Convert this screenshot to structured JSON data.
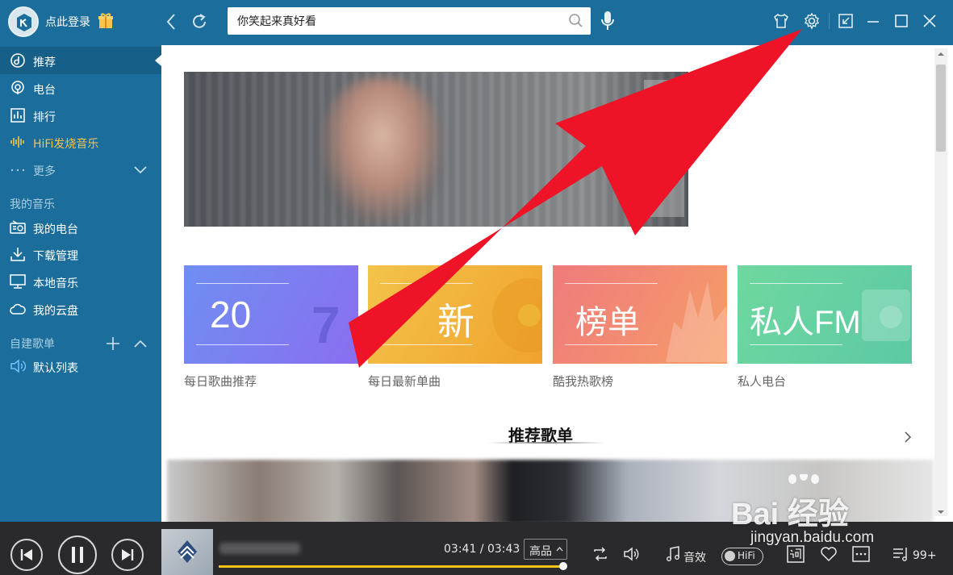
{
  "titlebar": {
    "login_text": "点此登录",
    "search_value": "你笑起来真好看"
  },
  "sidebar": {
    "items": [
      {
        "label": "推荐",
        "icon": "recommend-icon"
      },
      {
        "label": "电台",
        "icon": "radio-icon"
      },
      {
        "label": "排行",
        "icon": "chart-icon"
      },
      {
        "label": "HiFi发烧音乐",
        "icon": "waveform-icon"
      },
      {
        "label": "更多",
        "icon": "dots-icon"
      }
    ],
    "my_music_title": "我的音乐",
    "my_music": [
      {
        "label": "我的电台",
        "icon": "my-radio-icon"
      },
      {
        "label": "下载管理",
        "icon": "download-icon"
      },
      {
        "label": "本地音乐",
        "icon": "monitor-icon"
      },
      {
        "label": "我的云盘",
        "icon": "cloud-icon"
      }
    ],
    "playlists_title": "自建歌单",
    "playlists": [
      {
        "label": "默认列表",
        "icon": "speaker-icon"
      }
    ]
  },
  "main": {
    "cards": [
      {
        "big": "20",
        "caption": "每日歌曲推荐",
        "color": "#7a7ef1"
      },
      {
        "big": "新",
        "caption": "每日最新单曲",
        "color": "#f2b43c"
      },
      {
        "big": "榜单",
        "caption": "酷我热歌榜",
        "color": "#f28a70"
      },
      {
        "big": "私人FM",
        "caption": "私人电台",
        "color": "#66d1a2"
      }
    ],
    "section_title": "推荐歌单"
  },
  "player": {
    "current_time": "03:41",
    "total_time": "03:43",
    "time_sep": " / ",
    "quality": "高品",
    "effects_label": "音效",
    "hifi_label": "HiFi",
    "queue_count": "99+",
    "progress": 0.993
  },
  "watermark": {
    "brand": "Bai 经验",
    "url": "jingyan.baidu.com"
  },
  "colors": {
    "theme_blue": "#1b6e9c",
    "player_bg": "#2a2a2c",
    "hifi_gold": "#f6c34b",
    "progress_yellow": "#f4c21b",
    "arrow_red": "#ee1326"
  }
}
